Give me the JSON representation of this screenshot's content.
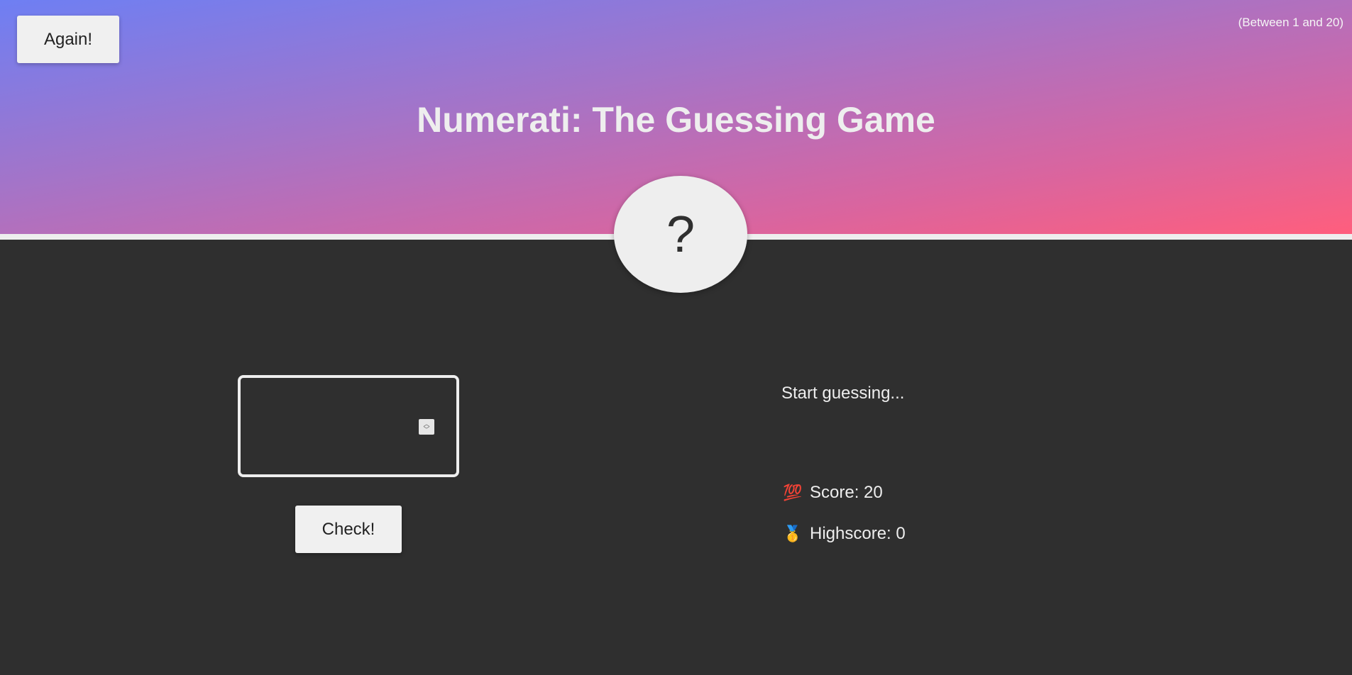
{
  "header": {
    "again_label": "Again!",
    "range_hint": "(Between 1 and 20)",
    "title": "Numerati: The Guessing Game",
    "secret_display": "?"
  },
  "left": {
    "guess_value": "",
    "check_label": "Check!"
  },
  "right": {
    "message": "Start guessing...",
    "score_emoji": "💯",
    "score_label": "Score: 20",
    "highscore_emoji": "🥇",
    "highscore_label": "Highscore: 0"
  },
  "colors": {
    "dark_background": "#2f2f2f",
    "light_text": "#eeeeee",
    "gradient_start": "#6e7ff3",
    "gradient_end": "#ff5e7d"
  },
  "icons": {
    "score": "hundred-points-icon",
    "highscore": "gold-medal-icon",
    "spinner": "number-spinner-icon"
  }
}
